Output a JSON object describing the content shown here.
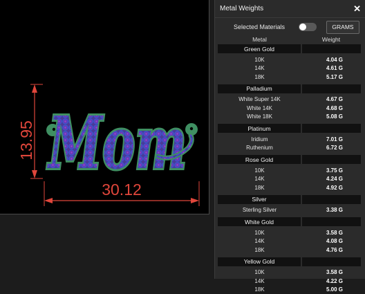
{
  "canvas": {
    "dim_vertical": "13.95",
    "dim_horizontal": "30.12",
    "pendant_text": "Mom",
    "colors": {
      "dimension": "#e0463b",
      "metal_green": "#3f8f62",
      "stone_purple": "#6a3aa8",
      "stone_blue": "#3a55c8"
    }
  },
  "panel": {
    "title": "Metal Weights",
    "close_icon": "close-icon",
    "selected_materials_label": "Selected Materials",
    "toggle_state": "off",
    "unit_button": "GRAMS",
    "columns": [
      "Metal",
      "Weight"
    ],
    "groups": [
      {
        "name": "Green Gold",
        "items": [
          {
            "label": "10K",
            "weight": "4.04 G"
          },
          {
            "label": "14K",
            "weight": "4.61 G"
          },
          {
            "label": "18K",
            "weight": "5.17 G"
          }
        ]
      },
      {
        "name": "Palladium",
        "items": [
          {
            "label": "White Super 14K",
            "weight": "4.67 G"
          },
          {
            "label": "White 14K",
            "weight": "4.68 G"
          },
          {
            "label": "White 18K",
            "weight": "5.08 G"
          }
        ]
      },
      {
        "name": "Platinum",
        "items": [
          {
            "label": "Iridium",
            "weight": "7.01 G"
          },
          {
            "label": "Ruthenium",
            "weight": "6.72 G"
          }
        ]
      },
      {
        "name": "Rose Gold",
        "items": [
          {
            "label": "10K",
            "weight": "3.75 G"
          },
          {
            "label": "14K",
            "weight": "4.24 G"
          },
          {
            "label": "18K",
            "weight": "4.92 G"
          }
        ]
      },
      {
        "name": "Silver",
        "items": [
          {
            "label": "Sterling Silver",
            "weight": "3.38 G"
          }
        ]
      },
      {
        "name": "White Gold",
        "items": [
          {
            "label": "10K",
            "weight": "3.58 G"
          },
          {
            "label": "14K",
            "weight": "4.08 G"
          },
          {
            "label": "18K",
            "weight": "4.76 G"
          }
        ]
      },
      {
        "name": "Yellow Gold",
        "items": [
          {
            "label": "10K",
            "weight": "3.58 G"
          },
          {
            "label": "14K",
            "weight": "4.22 G"
          },
          {
            "label": "18K",
            "weight": "5.00 G"
          }
        ]
      }
    ]
  }
}
